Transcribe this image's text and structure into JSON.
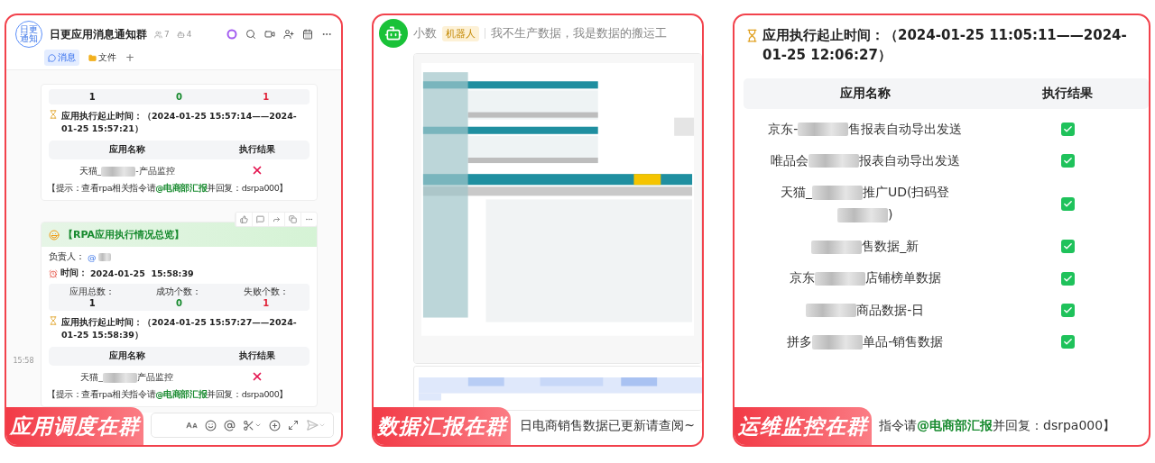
{
  "group_chat": {
    "avatar_lines": [
      "日更",
      "通知"
    ],
    "title": "日更应用消息通知群",
    "member_count": "7",
    "bot_count": "4",
    "tabs": [
      {
        "label": "消息",
        "selected": true
      },
      {
        "label": "文件",
        "selected": false
      }
    ],
    "add_tab": "+",
    "side_time": "15:58",
    "cards": [
      {
        "stats": [
          {
            "kind": "total",
            "value": "1"
          },
          {
            "kind": "success",
            "value": "0"
          },
          {
            "kind": "fail",
            "value": "1"
          }
        ],
        "time_range": "应用执行起止时间：（2024-01-25 15:57:14——2024-01-25 15:57:21）",
        "columns": [
          "应用名称",
          "执行结果"
        ],
        "rows": [
          {
            "segments": [
              {
                "kind": "text",
                "text": "天猫_"
              },
              {
                "kind": "blur"
              },
              {
                "kind": "text",
                "text": "-产品监控"
              }
            ],
            "success": false
          }
        ],
        "hint": {
          "before": "【提示：查看rpa相关指令请",
          "mention": "@电商部汇报",
          "after": "并回复：dsrpa000】"
        }
      },
      {
        "header": "【RPA应用执行情况总览】",
        "owner_label": "负责人：",
        "owner_mention": "@",
        "time_label": "时间：",
        "time": "2024-01-25  15:58:39",
        "stats": [
          {
            "kind": "total",
            "label": "应用总数：",
            "value": "1"
          },
          {
            "kind": "success",
            "label": "成功个数：",
            "value": "0"
          },
          {
            "kind": "fail",
            "label": "失败个数：",
            "value": "1"
          }
        ],
        "time_range": "应用执行起止时间：（2024-01-25 15:57:27——2024-01-25 15:58:39）",
        "columns": [
          "应用名称",
          "执行结果"
        ],
        "rows": [
          {
            "segments": [
              {
                "kind": "text",
                "text": "天猫_"
              },
              {
                "kind": "blur"
              },
              {
                "kind": "text",
                "text": "产品监控"
              }
            ],
            "success": false
          }
        ],
        "hint": {
          "before": "【提示：查看rpa相关指令请",
          "mention": "@电商部汇报",
          "after": "并回复：dsrpa000】"
        }
      }
    ],
    "badge": "应用调度在群"
  },
  "data_bot": {
    "name": "小数",
    "tag": "机器人",
    "motto": "我不生产数据，我是数据的搬运工",
    "message": "日电商销售数据已更新请查阅~",
    "badge": "数据汇报在群"
  },
  "ops_monitor": {
    "time_range": "应用执行起止时间：（2024-01-25 11:05:11——2024-01-25 12:06:27）",
    "columns": [
      "应用名称",
      "执行结果"
    ],
    "rows": [
      {
        "segments": [
          {
            "kind": "text",
            "text": "京东-"
          },
          {
            "kind": "blur"
          },
          {
            "kind": "text",
            "text": "售报表自动导出发送"
          }
        ],
        "success": true
      },
      {
        "segments": [
          {
            "kind": "text",
            "text": "唯品会"
          },
          {
            "kind": "blur"
          },
          {
            "kind": "text",
            "text": "报表自动导出发送"
          }
        ],
        "success": true
      },
      {
        "segments": [
          {
            "kind": "text",
            "text": "天猫_"
          },
          {
            "kind": "blur"
          },
          {
            "kind": "text",
            "text": "推广UD(扫码登"
          },
          {
            "kind": "break"
          },
          {
            "kind": "blur"
          },
          {
            "kind": "text",
            "text": ")"
          }
        ],
        "success": true
      },
      {
        "segments": [
          {
            "kind": "blur"
          },
          {
            "kind": "text",
            "text": "售数据_新"
          }
        ],
        "success": true
      },
      {
        "segments": [
          {
            "kind": "text",
            "text": "京东"
          },
          {
            "kind": "blur"
          },
          {
            "kind": "text",
            "text": "店铺榜单数据"
          }
        ],
        "success": true
      },
      {
        "segments": [
          {
            "kind": "blur"
          },
          {
            "kind": "text",
            "text": "商品数据-日"
          }
        ],
        "success": true
      },
      {
        "segments": [
          {
            "kind": "text",
            "text": "拼多"
          },
          {
            "kind": "blur"
          },
          {
            "kind": "text",
            "text": "单品-销售数据"
          }
        ],
        "success": true
      }
    ],
    "hint": {
      "before": "指令请",
      "mention": "@电商部汇报",
      "after": "并回复：dsrpa000】"
    },
    "badge": "运维监控在群"
  }
}
